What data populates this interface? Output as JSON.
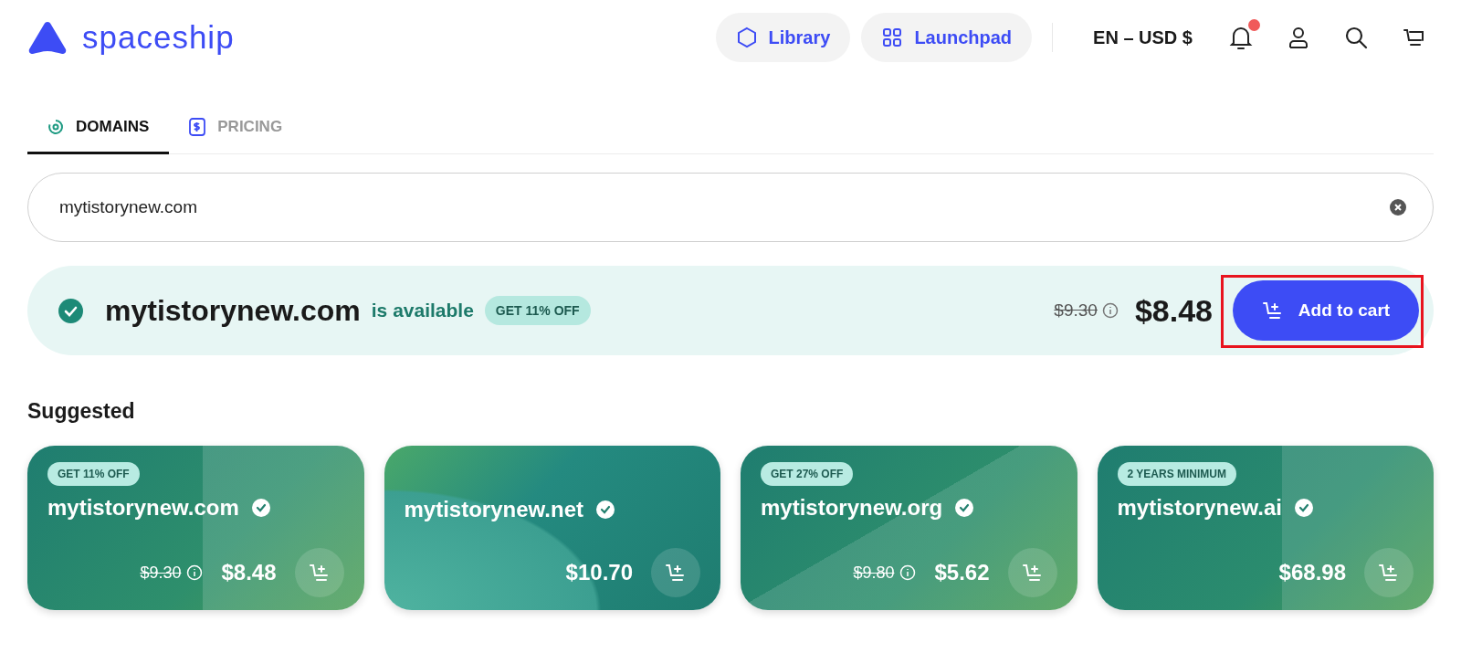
{
  "header": {
    "logo": "spaceship",
    "nav": [
      {
        "label": "Library",
        "kind": "hexagon"
      },
      {
        "label": "Launchpad",
        "kind": "grid"
      }
    ],
    "locale": "EN – USD $",
    "notifications_unread": true
  },
  "tabs": [
    {
      "label": "DOMAINS",
      "kind": "target",
      "selected": true
    },
    {
      "label": "PRICING",
      "kind": "dollar",
      "selected": false
    }
  ],
  "search": {
    "value": "mytistorynew.com"
  },
  "result": {
    "domain": "mytistorynew.com",
    "status": "is available",
    "badge": "GET 11% OFF",
    "old_price": "$9.30",
    "price": "$8.48",
    "button": "Add to cart",
    "highlighted": true
  },
  "suggested": {
    "title": "Suggested",
    "cards": [
      {
        "badge": "GET 11% OFF",
        "domain": "mytistorynew.com",
        "old_price": "$9.30",
        "price": "$8.48"
      },
      {
        "domain": "mytistorynew.net",
        "price": "$10.70"
      },
      {
        "badge": "GET 27% OFF",
        "domain": "mytistorynew.org",
        "old_price": "$9.80",
        "price": "$5.62"
      },
      {
        "badge": "2 YEARS MINIMUM",
        "domain": "mytistorynew.ai",
        "price": "$68.98"
      }
    ]
  }
}
